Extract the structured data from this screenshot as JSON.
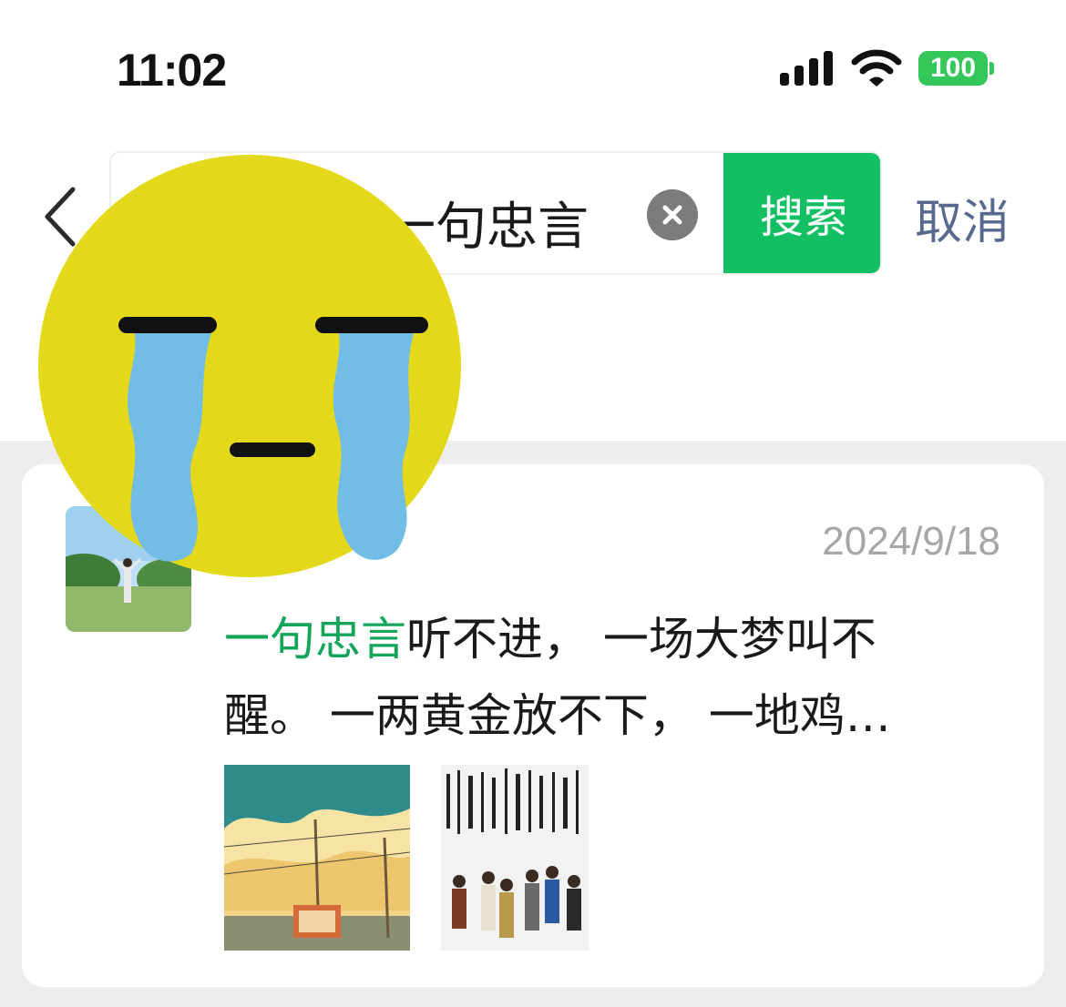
{
  "status_bar": {
    "time": "11:02",
    "battery_level": "100",
    "battery_color": "#34c759"
  },
  "search": {
    "query": "一句忠言",
    "search_button_label": "搜索",
    "cancel_label": "取消",
    "accent_color": "#12c063"
  },
  "result": {
    "name": "",
    "date": "2024/9/18",
    "snippet_highlight": "一句忠言",
    "snippet_line1_rest": "听不进， 一场大梦叫不",
    "snippet_line2": "醒。 一两黄金放不下， 一地鸡…"
  },
  "icons": {
    "back": "chevron-left-icon",
    "clear": "clear-x-icon",
    "signal": "cellular-signal-icon",
    "wifi": "wifi-icon",
    "sticker": "crying-face-sticker"
  }
}
